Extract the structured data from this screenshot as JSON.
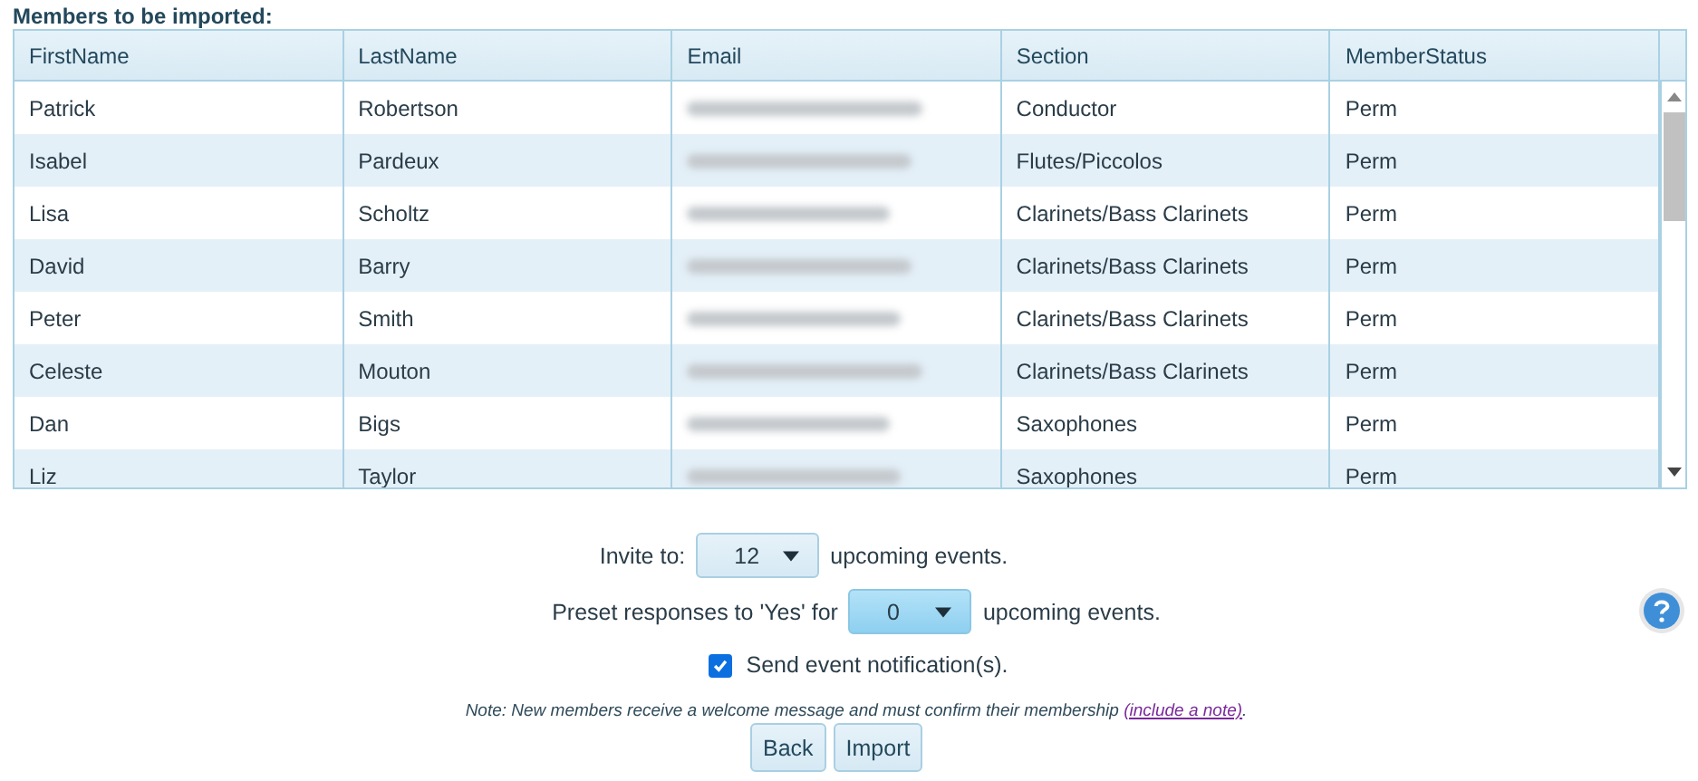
{
  "heading": "Members to be imported:",
  "table": {
    "columns": [
      "FirstName",
      "LastName",
      "Email",
      "Section",
      "MemberStatus"
    ],
    "rows": [
      {
        "first": "Patrick",
        "last": "Robertson",
        "section": "Conductor",
        "status": "Perm"
      },
      {
        "first": "Isabel",
        "last": "Pardeux",
        "section": "Flutes/Piccolos",
        "status": "Perm"
      },
      {
        "first": "Lisa",
        "last": "Scholtz",
        "section": "Clarinets/Bass Clarinets",
        "status": "Perm"
      },
      {
        "first": "David",
        "last": "Barry",
        "section": "Clarinets/Bass Clarinets",
        "status": "Perm"
      },
      {
        "first": "Peter",
        "last": "Smith",
        "section": "Clarinets/Bass Clarinets",
        "status": "Perm"
      },
      {
        "first": "Celeste",
        "last": "Mouton",
        "section": "Clarinets/Bass Clarinets",
        "status": "Perm"
      },
      {
        "first": "Dan",
        "last": "Bigs",
        "section": "Saxophones",
        "status": "Perm"
      },
      {
        "first": "Liz",
        "last": "Taylor",
        "section": "Saxophones",
        "status": "Perm"
      }
    ]
  },
  "invite": {
    "label": "Invite to:",
    "value": "12",
    "focused": false,
    "suffix": "upcoming events."
  },
  "preset": {
    "label": "Preset responses to 'Yes' for",
    "value": "0",
    "focused": true,
    "suffix": "upcoming events."
  },
  "notify": {
    "label": "Send event notification(s).",
    "checked": true
  },
  "note": {
    "text": "Note: New members receive a welcome message and must confirm their membership",
    "link": "(include a note)",
    "end": "."
  },
  "buttons": [
    "Back",
    "Import"
  ]
}
